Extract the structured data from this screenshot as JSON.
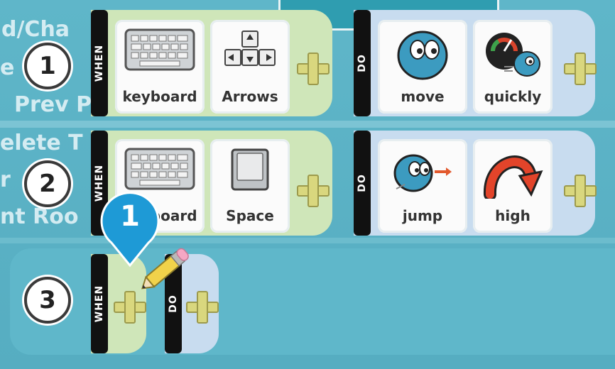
{
  "left_menu": [
    "d/Cha",
    "e",
    "Prev P",
    "elete T",
    "r",
    "nt Roo"
  ],
  "rows": [
    {
      "number": "1",
      "when_label": "WHEN",
      "do_label": "DO",
      "when_cards": [
        {
          "label": "keyboard",
          "icon": "keyboard-icon"
        },
        {
          "label": "Arrows",
          "icon": "arrow-keys-icon"
        }
      ],
      "do_cards": [
        {
          "label": "move",
          "icon": "move-character-icon"
        },
        {
          "label": "quickly",
          "icon": "speedometer-icon"
        }
      ]
    },
    {
      "number": "2",
      "when_label": "WHEN",
      "do_label": "DO",
      "when_cards": [
        {
          "label": "keyboard",
          "icon": "keyboard-icon"
        },
        {
          "label": "Space",
          "icon": "space-key-icon"
        }
      ],
      "do_cards": [
        {
          "label": "jump",
          "icon": "jump-character-icon"
        },
        {
          "label": "high",
          "icon": "curved-arrow-icon"
        }
      ]
    },
    {
      "number": "3",
      "when_label": "WHEN",
      "do_label": "DO"
    }
  ],
  "marker": {
    "text": "1",
    "color": "#1e9ad6"
  },
  "colors": {
    "background": "#5fb6c9",
    "when_panel": "#cfe6b9",
    "do_panel": "#c8dcef",
    "plus": "#d9d77e"
  }
}
